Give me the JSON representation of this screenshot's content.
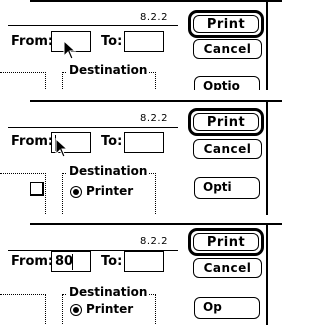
{
  "dialog": {
    "version": "8.2.2",
    "print_label": "Print",
    "cancel_label": "Cancel",
    "from_label": "From:",
    "to_label": "To:",
    "destination_label": "Destination",
    "printer_label": "Printer",
    "options_frame1": "Optio",
    "options_frame2": "Opti",
    "options_frame3": "Op"
  },
  "frames": [
    {
      "from_value": "",
      "to_value": ""
    },
    {
      "from_value": "",
      "to_value": ""
    },
    {
      "from_value": "80",
      "to_value": ""
    }
  ]
}
